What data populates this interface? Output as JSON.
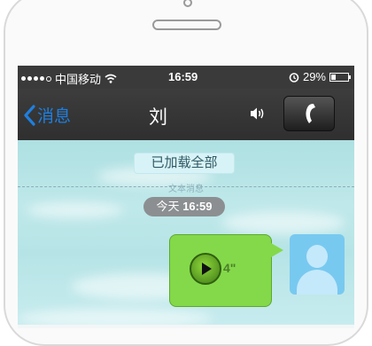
{
  "status_bar": {
    "carrier": "中国移动",
    "time": "16:59",
    "battery": "29%",
    "battery_level": 0.29
  },
  "nav": {
    "back_label": "消息",
    "title": "刘"
  },
  "chat": {
    "loaded_label": "已加载全部",
    "divider_label": "文本消息",
    "time_prefix": "今天",
    "time": "16:59",
    "voice_duration": "4\""
  },
  "colors": {
    "accent": "#1e7fe0",
    "bubble": "#84d94a",
    "avatar": "#78c9f0"
  }
}
